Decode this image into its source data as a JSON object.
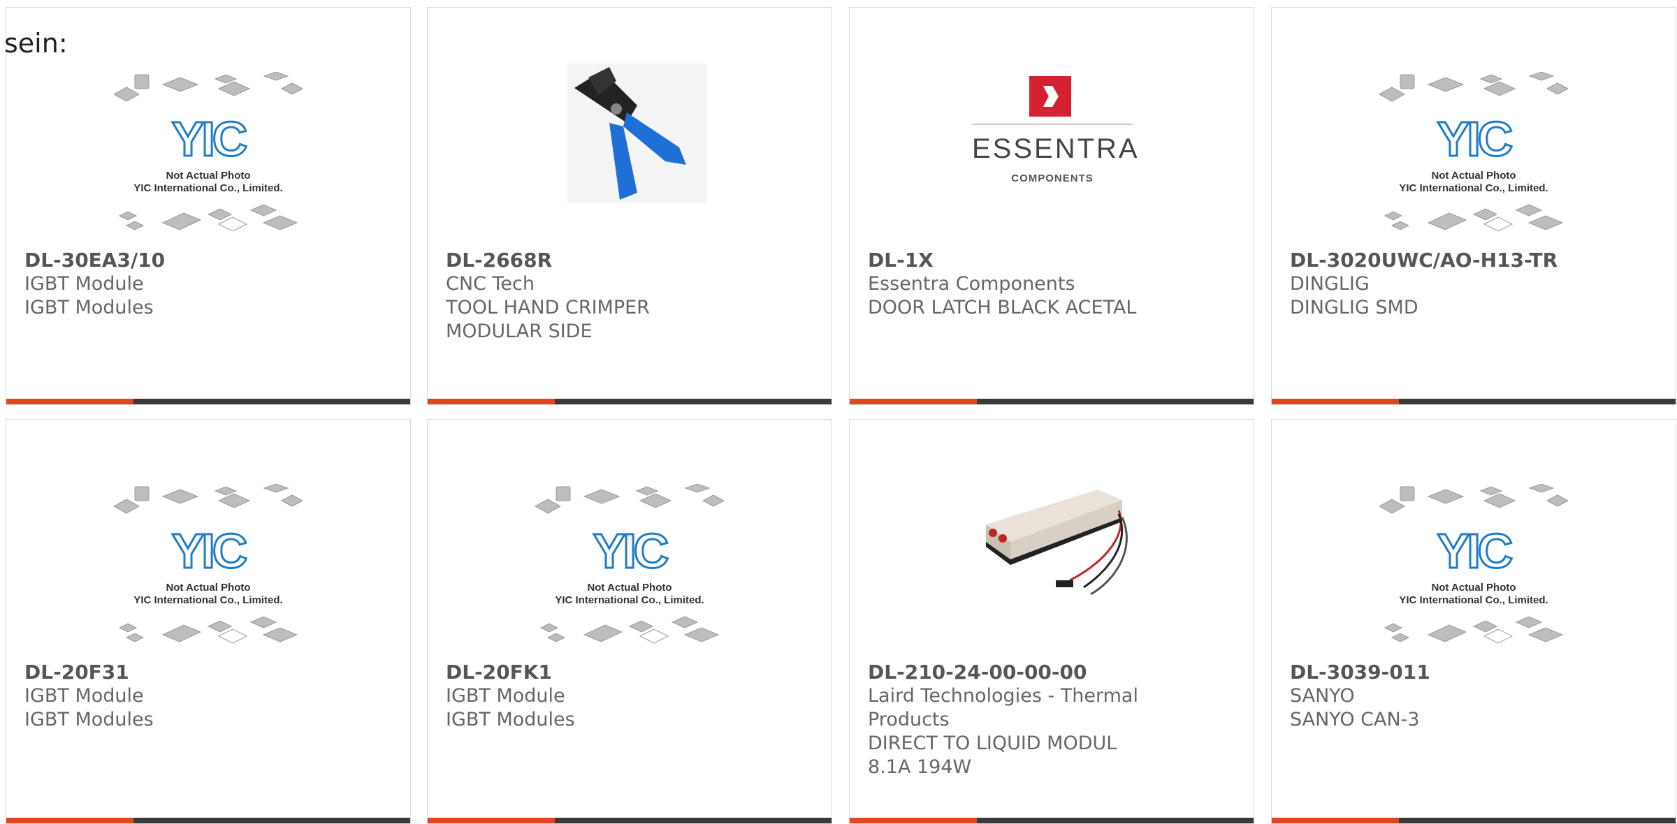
{
  "page": {
    "intro_text": "sein:"
  },
  "placeholder": {
    "brand": "YIC",
    "line1": "Not Actual Photo",
    "line2": "YIC International Co., Limited."
  },
  "essentra_logo": {
    "name": "ESSENTRA",
    "sub": "COMPONENTS"
  },
  "colors": {
    "accent": "#e0461f",
    "bar": "#3a3a3a",
    "border": "#d9d9d9",
    "brand_blue": "#1f7cc7"
  },
  "products": [
    {
      "part": "DL-30EA3/10",
      "maker": "IGBT Module",
      "desc": "IGBT Modules",
      "image": "yic-placeholder"
    },
    {
      "part": "DL-2668R",
      "maker": "CNC Tech",
      "desc": "TOOL HAND CRIMPER MODULAR SIDE",
      "image": "crimper-tool"
    },
    {
      "part": "DL-1X",
      "maker": "Essentra Components",
      "desc": "DOOR LATCH BLACK ACETAL",
      "image": "essentra-logo"
    },
    {
      "part": "DL-3020UWC/AO-H13-TR",
      "maker": "DINGLIG",
      "desc": "DINGLIG SMD",
      "image": "yic-placeholder"
    },
    {
      "part": "DL-20F31",
      "maker": "IGBT Module",
      "desc": "IGBT Modules",
      "image": "yic-placeholder"
    },
    {
      "part": "DL-20FK1",
      "maker": "IGBT Module",
      "desc": "IGBT Modules",
      "image": "yic-placeholder"
    },
    {
      "part": "DL-210-24-00-00-00",
      "maker": "Laird Technologies - Thermal Products",
      "desc": "DIRECT TO LIQUID MODUL 8.1A 194W",
      "image": "liquid-module"
    },
    {
      "part": "DL-3039-011",
      "maker": "SANYO",
      "desc": "SANYO CAN-3",
      "image": "yic-placeholder"
    }
  ]
}
